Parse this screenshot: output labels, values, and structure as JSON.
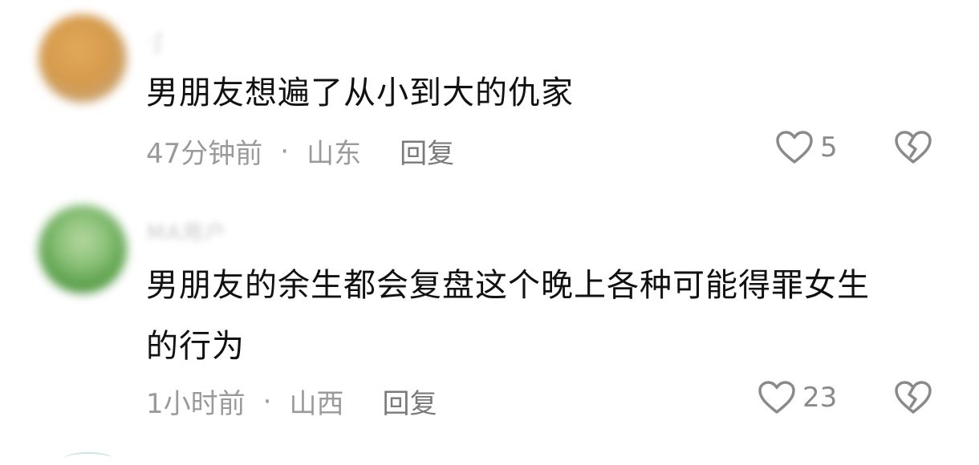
{
  "comments": [
    {
      "username": "·ʃ",
      "text": "男朋友想遍了从小到大的仇家",
      "time": "47分钟前",
      "separator": "·",
      "location": "山东",
      "reply_label": "回复",
      "likes": "5"
    },
    {
      "username": "MA用户",
      "text_line1": "男朋友的余生都会复盘这个晚上各种可能得罪女生",
      "text_line2": "的行为",
      "time": "1小时前",
      "separator": "·",
      "location": "山西",
      "reply_label": "回复",
      "likes": "23"
    }
  ],
  "icons": {
    "like": "heart-outline-icon",
    "dislike": "broken-heart-icon"
  },
  "colors": {
    "text": "#111111",
    "meta": "#9a9a9a",
    "icon": "#8a8a8a"
  }
}
